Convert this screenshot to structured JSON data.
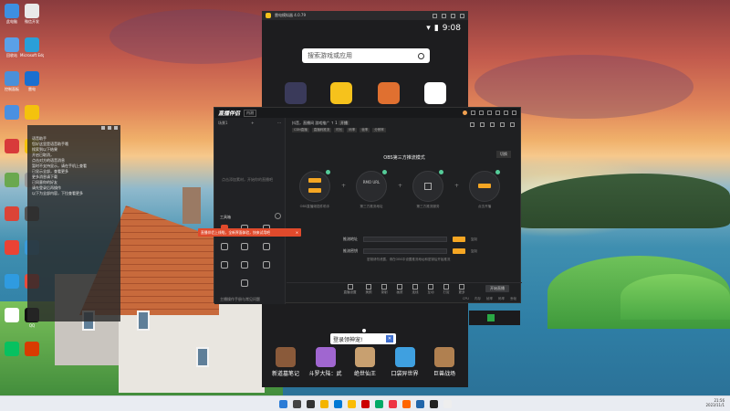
{
  "desktop": {
    "icons": [
      {
        "label": "此电脑",
        "color": "#3d8fe0"
      },
      {
        "label": "微信开发",
        "color": "#e9e9e9"
      },
      {
        "label": "回收站",
        "color": "#5aa0e8"
      },
      {
        "label": "Microsoft Edge",
        "color": "#2a9fd8"
      },
      {
        "label": "控制面板",
        "color": "#4a90d9"
      },
      {
        "label": "雷电",
        "color": "#1a6fd0"
      },
      {
        "label": "",
        "color": "#4a90e2"
      },
      {
        "label": "",
        "color": "#f4c20d"
      },
      {
        "label": "",
        "color": "#d83a3a"
      },
      {
        "label": "",
        "color": "#f4c20d"
      },
      {
        "label": "",
        "color": "#6aa84f"
      },
      {
        "label": "",
        "color": "#999"
      },
      {
        "label": "",
        "color": "#db4437"
      },
      {
        "label": "",
        "color": "#555"
      },
      {
        "label": "",
        "color": "#ea4335"
      },
      {
        "label": "",
        "color": "#3a9ad9"
      },
      {
        "label": "",
        "color": "#2f9be0"
      },
      {
        "label": "",
        "color": "#e74c3c"
      },
      {
        "label": "",
        "color": "#fff"
      },
      {
        "label": "QQ",
        "color": "#111"
      },
      {
        "label": "",
        "color": "#07c160"
      },
      {
        "label": "",
        "color": "#d83b01"
      }
    ]
  },
  "note_panel": {
    "lines": [
      "语音助手",
      "您好这里是语音助手哦",
      "搜索到以下结果",
      "开启已取消，",
      "点击对方的语音消息",
      "暂时不支持显示，请在手机上查看",
      "已显示全部，查看更多",
      "更多消息请下载",
      "已同意你的好友",
      "请先登录后再操作",
      "以下为全部内容，下拉查看更多"
    ]
  },
  "phone": {
    "title": "雷电模拟器 4.0.79",
    "time": "9:08",
    "search_placeholder": "搜索游戏或应用",
    "banner_text": "登录领神宠!",
    "banner_close": "✕",
    "games": [
      {
        "label": "新道墓笔记",
        "color": "#8a5a3a"
      },
      {
        "label": "斗罗大陆：武",
        "color": "#a066d0"
      },
      {
        "label": "绝世仙王",
        "color": "#c8a070"
      },
      {
        "label": "口袋异世界",
        "color": "#3fa0e0"
      },
      {
        "label": "巨兽战场",
        "color": "#b08050"
      }
    ],
    "apps": [
      {
        "name": "app-folder",
        "color": "#3a3a5a"
      },
      {
        "name": "game-center",
        "color": "#f6c21c"
      },
      {
        "name": "clash-game",
        "color": "#e07030"
      },
      {
        "name": "qq-app",
        "color": "#ffffff"
      }
    ]
  },
  "main": {
    "brand": "直播伴侣",
    "version": "内测",
    "sidebar": {
      "tabs": [
        "场景1",
        "+",
        "···"
      ],
      "hint": "点击添加素材，开始你的直播吧",
      "tools_title": "工具箱",
      "tools": [
        "",
        "",
        "",
        "",
        "",
        "",
        "",
        "",
        "",
        ""
      ],
      "footer": "主播操作手册与常见问题"
    },
    "toast": {
      "text": "直播伴侣上线啦，全新界面体验，快来试用吧",
      "close": "✕"
    },
    "header": {
      "line1": "抖音，直播间 游戏推广 ↑ 1",
      "button": "开播",
      "tags": [
        "CDN直播",
        "直播码推流",
        "时长",
        "码率",
        "帧率",
        "分辨率"
      ]
    },
    "mode_title": "OBS第三方推流模式",
    "mode_btn": "切换",
    "nodes": [
      {
        "mid": "",
        "label": "OBS直播姬插件助手"
      },
      {
        "mid": "RMO URL",
        "label": "第三方推流地址"
      },
      {
        "mid": "",
        "label": "第三方推流服务"
      },
      {
        "mid": "",
        "label": "点击开播"
      }
    ],
    "rows": [
      {
        "label": "推流地址",
        "ext": "复制"
      },
      {
        "label": "推流密钥",
        "ext": "复制"
      }
    ],
    "footnote": "密钥请勿泄露，请在OBS中设置推流地址和密钥后开始推流",
    "toolbar": [
      "直播设置",
      "美颜",
      "录制",
      "画质",
      "连线",
      "互动",
      "打赏",
      "更多"
    ],
    "start_btn": "开始直播",
    "stats": [
      "CPU",
      "内存",
      "帧率",
      "码率",
      "丢帧"
    ]
  },
  "taskbar": {
    "icons": [
      "#2b7bd6",
      "#444",
      "#333",
      "#f4b400",
      "#0078d4",
      "#fbbc05",
      "#c00",
      "#0a6",
      "#e34",
      "#f60",
      "#26a",
      "#222",
      "#eee"
    ],
    "time": "21:56",
    "date": "2023/11/1"
  }
}
